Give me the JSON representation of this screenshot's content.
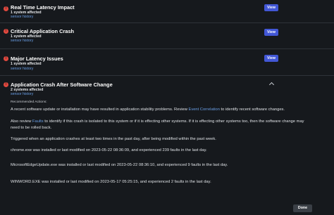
{
  "colors": {
    "background": "#16191d",
    "error": "#e0483e",
    "link": "#6a9fe6",
    "button": "#4257d6"
  },
  "issues": [
    {
      "title": "Real Time Latency Impact",
      "affected": "1 system affected",
      "link": "sensor history",
      "view_label": "View",
      "icon": "error-icon"
    },
    {
      "title": "Critical Application Crash",
      "affected": "1 system affected",
      "link": "sensor history",
      "view_label": "View",
      "icon": "error-icon"
    },
    {
      "title": "Major Latency Issues",
      "affected": "1 system affected",
      "link": "sensor history",
      "view_label": "View",
      "icon": "error-icon"
    },
    {
      "title": "Application Crash After Software Change",
      "affected": "2 systems affected",
      "link": "sensor history",
      "icon": "error-icon",
      "expanded": true
    }
  ],
  "details": {
    "recommended_label": "Recommended Actions:",
    "p1_before": "A recent software update or installation may have resulted in application stability problems. Review ",
    "p1_link": "Event Correlation",
    "p1_after": " to identify recent software changes.",
    "p2_before": "Also review ",
    "p2_link": "Faults",
    "p2_after": " to identify if this crash is isolated to this system or if it is effecting other systems. If it is effecting other systems too, then the software change may",
    "p2_line2": "need to be rolled back.",
    "p3": "Triggered when an application crashes at least two times in the past day, after being modified within the past week.",
    "p4": "chrome.exe was installed or last modified on 2023-05-22 08:36:09, and experienced 239 faults in the last day.",
    "p5": "MicrosoftEdgeUpdate.exe was installed or last modified on 2023-05-22 08:36:10, and experienced 9 faults in the last day.",
    "p6": "WINWORD.EXE was installed or last modified on 2023-05-17 05:25:15, and experienced 2 faults in the last day."
  },
  "footer": {
    "done_label": "Done"
  }
}
